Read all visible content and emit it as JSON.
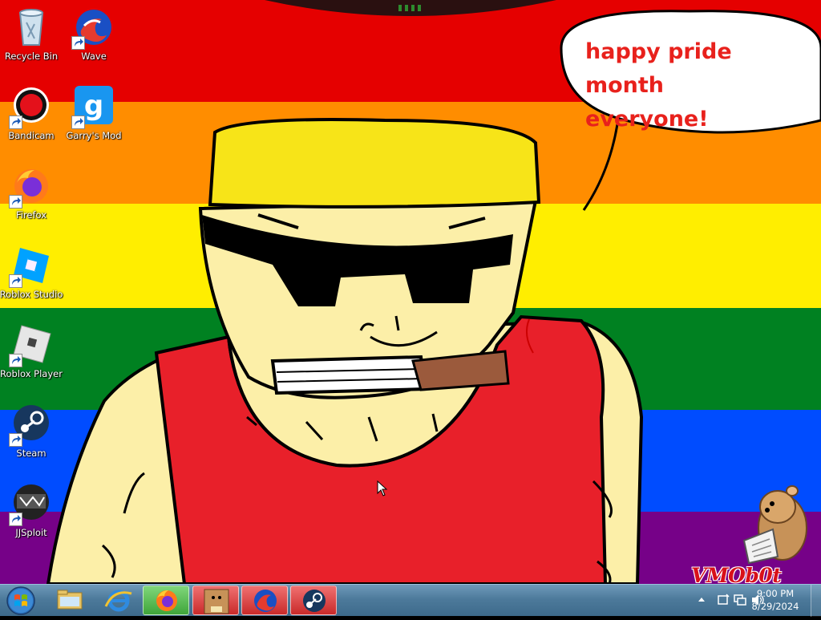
{
  "desktop": {
    "speech_bubble": {
      "line1": "happy pride month",
      "line2": "everyone!"
    },
    "watermark": "VMOb0t",
    "icons": [
      {
        "label": "Recycle Bin",
        "icon": "recycle-bin-icon"
      },
      {
        "label": "Wave",
        "icon": "wave-icon"
      },
      {
        "label": "Bandicam",
        "icon": "bandicam-icon"
      },
      {
        "label": "Garry's Mod",
        "icon": "garrys-mod-icon"
      },
      {
        "label": "Firefox",
        "icon": "firefox-icon"
      },
      {
        "label": "Roblox Studio",
        "icon": "roblox-studio-icon"
      },
      {
        "label": "Roblox Player",
        "icon": "roblox-player-icon"
      },
      {
        "label": "Steam",
        "icon": "steam-icon"
      },
      {
        "label": "JJSploit",
        "icon": "jjsploit-icon"
      }
    ]
  },
  "taskbar": {
    "start_icon": "windows-start-orb-icon",
    "pinned": [
      {
        "name": "Windows Explorer",
        "icon": "folder-icon"
      },
      {
        "name": "Internet Explorer",
        "icon": "internet-explorer-icon"
      },
      {
        "name": "Firefox",
        "icon": "firefox-icon"
      },
      {
        "name": "Box",
        "icon": "box-icon"
      },
      {
        "name": "Wave",
        "icon": "wave-icon"
      },
      {
        "name": "Steam",
        "icon": "steam-icon"
      }
    ],
    "tray": {
      "time": "9:00 PM",
      "date": "8/29/2024",
      "icons": [
        "show-hidden-icon",
        "action-center-icon",
        "network-icon",
        "volume-icon"
      ]
    }
  },
  "colors": {
    "pride_red": "#e50000",
    "pride_orange": "#ff8d00",
    "pride_yellow": "#ffee00",
    "pride_green": "#008121",
    "pride_blue": "#004cff",
    "pride_purple": "#760188",
    "bubble_text": "#e8211c",
    "taskbar": "#4d7a9b"
  }
}
